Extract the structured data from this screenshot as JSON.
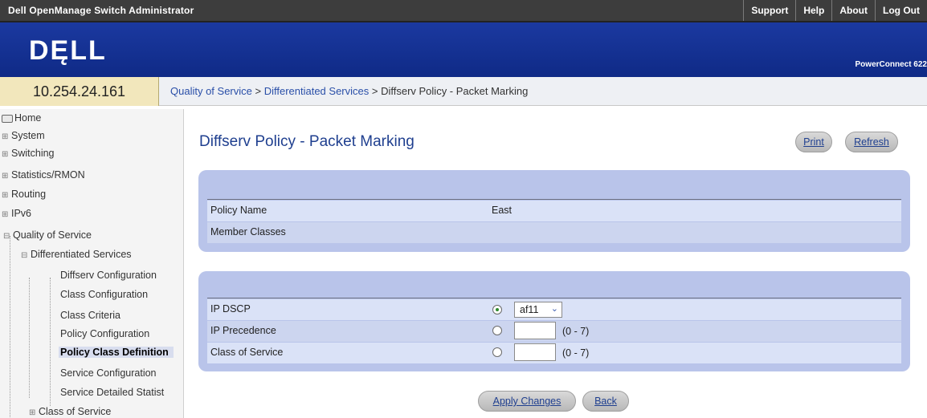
{
  "header": {
    "app_title": "Dell OpenManage Switch Administrator",
    "links": [
      "Support",
      "Help",
      "About",
      "Log Out"
    ],
    "logo": "DĘLL",
    "product": "PowerConnect 622"
  },
  "address": {
    "ip": "10.254.24.161",
    "breadcrumb": [
      "Quality of Service",
      "Differentiated Services",
      "Diffserv Policy - Packet Marking"
    ],
    "separator": " > "
  },
  "nav": {
    "home": "Home",
    "system": "System",
    "switching": "Switching",
    "statistics": "Statistics/RMON",
    "routing": "Routing",
    "ipv6": "IPv6",
    "qos": "Quality of Service",
    "diffserv": "Differentiated Services",
    "diffserv_config": "Diffserv Configuration",
    "class_config": "Class Configuration",
    "class_criteria": "Class Criteria",
    "policy_config": "Policy Configuration",
    "policy_class_def": "Policy Class Definition",
    "service_config": "Service Configuration",
    "service_detailed": "Service Detailed Statist",
    "class_of_service": "Class of Service",
    "toggle_plus": "⊞",
    "toggle_minus": "⊟"
  },
  "main": {
    "title": "Diffserv Policy - Packet Marking",
    "print_label": "Print",
    "refresh_label": "Refresh",
    "policy_name_label": "Policy Name",
    "policy_name_value": "East",
    "member_classes_label": "Member Classes",
    "ip_dscp_label": "IP DSCP",
    "ip_dscp_value": "af11",
    "ip_precedence_label": "IP Precedence",
    "ip_precedence_range": "(0 - 7)",
    "cos_label": "Class of Service",
    "cos_range": "(0 - 7)",
    "apply_label": "Apply Changes",
    "back_label": "Back"
  },
  "colors": {
    "brand_blue": "#0f2a86",
    "panel_blue": "#b9c4ea",
    "link_blue": "#1f3f8f"
  }
}
